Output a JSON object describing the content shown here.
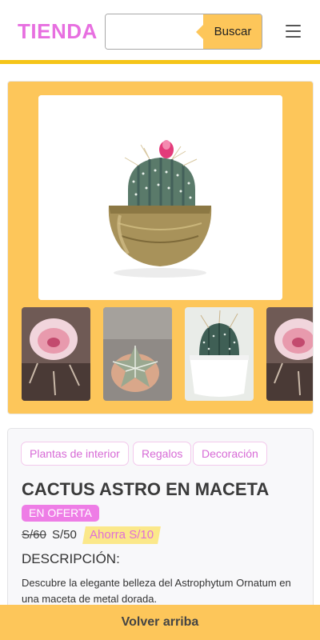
{
  "header": {
    "logo": "TIENDA",
    "search": {
      "value": "",
      "placeholder": "",
      "button_label": "Buscar"
    },
    "menu_icon": "hamburger-menu-icon"
  },
  "gallery": {
    "main_image": "cactus-astro-golden-pot",
    "thumbnails": [
      "pink-flower-cactus",
      "star-cactus-in-hand",
      "cactus-white-pot",
      "pink-flower-cactus"
    ]
  },
  "product": {
    "tags": [
      "Plantas de interior",
      "Regalos",
      "Decoración"
    ],
    "title": "CACTUS ASTRO EN MACETA",
    "badge": "EN OFERTA",
    "old_price": "S/60",
    "new_price": "S/50",
    "savings": "Ahorra S/10",
    "description_title": "DESCRIPCIÓN:",
    "description_text": "Descubre la elegante belleza del Astrophytum Ornatum en una maceta de metal dorada."
  },
  "footer": {
    "back_to_top": "Volver arriba"
  },
  "colors": {
    "brand_pink": "#e76fe0",
    "accent_yellow": "#fdc65a",
    "header_border": "#f5c518"
  }
}
